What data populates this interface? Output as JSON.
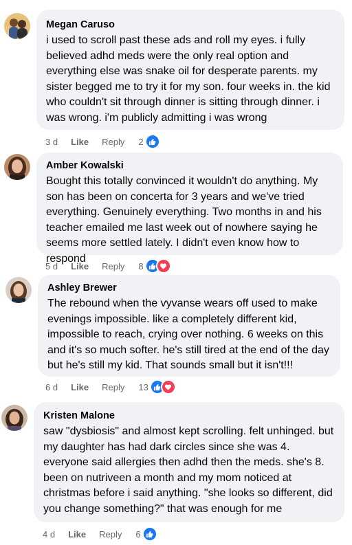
{
  "comments": [
    {
      "name": "Megan Caruso",
      "text": "i used to scroll past these ads and roll my eyes. i fully believed adhd meds were the only real option and everything else was snake oil for desperate parents. my sister begged me to try it for my son. four weeks in. the kid who couldn't sit through dinner is sitting through dinner. i was wrong. i'm publicly admitting i was wrong",
      "time": "3 d",
      "like": "Like",
      "reply": "Reply",
      "reaction_count": "2",
      "reactions": [
        "like-icon"
      ]
    },
    {
      "name": "Amber Kowalski",
      "text": "Bought this totally convinced it wouldn't do anything. My son has been on concerta for 3 years and we've tried everything. Genuinely everything. Two months in and his teacher emailed me last week out of nowhere saying he seems more settled lately. I didn't even know how to respond",
      "time": "5 d",
      "like": "Like",
      "reply": "Reply",
      "reaction_count": "8",
      "reactions": [
        "like-icon",
        "love-icon"
      ]
    },
    {
      "name": "Ashley Brewer",
      "text": "The rebound when the vyvanse wears off used to make evenings impossible. like a completely different kid, impossible to reach, crying over nothing. 6 weeks on this and it's so much softer. he's still tired at the end of the day but he's still my kid. That sounds small but it isn't!!!",
      "time": "6 d",
      "like": "Like",
      "reply": "Reply",
      "reaction_count": "13",
      "reactions": [
        "like-icon",
        "love-icon"
      ]
    },
    {
      "name": "Kristen Malone",
      "text": "saw \"dysbiosis\" and almost kept scrolling. felt unhinged. but my daughter has had dark circles since she was 4. everyone said allergies then adhd then the meds. she's 8. been on nutriveen a month and my mom noticed at christmas before i said anything. \"she looks so different, did you change something?\" that was enough for me",
      "time": "4 d",
      "like": "Like",
      "reply": "Reply",
      "reaction_count": "6",
      "reactions": [
        "like-icon"
      ]
    }
  ],
  "colors": {
    "bubble": "#f0f2f5",
    "meta_text": "#65676b",
    "like_blue": "#1877f2",
    "love_red": "#f33e58"
  }
}
